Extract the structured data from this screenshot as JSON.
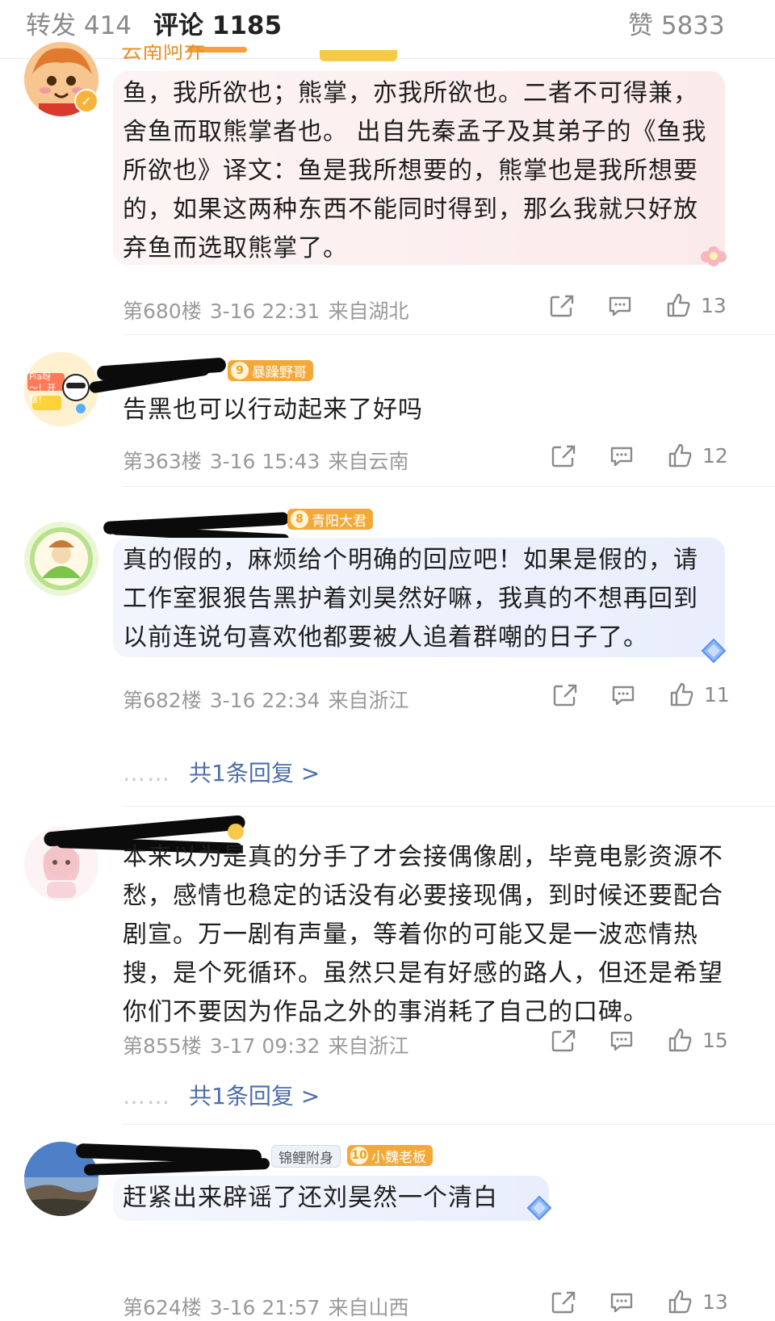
{
  "tabs": {
    "repost": "转发 414",
    "comments": "评论 1185",
    "likes": "赞 5833"
  },
  "comments": [
    {
      "text": "鱼，我所欲也；熊掌，亦我所欲也。二者不可得兼，舍鱼而取熊掌者也。 出自先秦孟子及其弟子的《鱼我所欲也》译文：鱼是我所想要的，熊掌也是我所想要的，如果这两种东西不能同时得到，那么我就只好放弃鱼而选取熊掌了。",
      "floor": "第680楼",
      "time": "3-16 22:31",
      "location": "来自湖北",
      "likes": "13",
      "name_visible": "云南阿乔"
    },
    {
      "text": "告黑也可以行动起来了好吗",
      "floor": "第363楼",
      "time": "3-16 15:43",
      "location": "来自云南",
      "likes": "12",
      "badge_level": "9",
      "badge_text": "暴躁野哥",
      "avatar_text": "Pia呀～！开摆！"
    },
    {
      "text": "真的假的，麻烦给个明确的回应吧！如果是假的，请工作室狠狠告黑护着刘昊然好嘛，我真的不想再回到以前连说句喜欢他都要被人追着群嘲的日子了。",
      "floor": "第682楼",
      "time": "3-16 22:34",
      "location": "来自浙江",
      "likes": "11",
      "badge_level": "8",
      "badge_text": "青阳大君",
      "reply_link": "共1条回复 >"
    },
    {
      "text": "本来以为是真的分手了才会接偶像剧，毕竟电影资源不愁，感情也稳定的话没有必要接现偶，到时候还要配合剧宣。万一剧有声量，等着你的可能又是一波恋情热搜，是个死循环。虽然只是有好感的路人，但还是希望你们不要因为作品之外的事消耗了自己的口碑。",
      "floor": "第855楼",
      "time": "3-17 09:32",
      "location": "来自浙江",
      "likes": "15",
      "reply_link": "共1条回复 >"
    },
    {
      "text": "赶紧出来辟谣了还刘昊然一个清白",
      "floor": "第624楼",
      "time": "3-16 21:57",
      "location": "来自山西",
      "likes": "13",
      "badge1_text": "锦鲤附身",
      "badge_level": "10",
      "badge_text": "小魏老板"
    }
  ],
  "reply_dots": "……",
  "colors": {
    "accent": "#f5a03c",
    "link": "#4b6ea8",
    "meta": "#9a9a9a"
  },
  "icons": [
    "share-icon",
    "comment-icon",
    "thumbs-up-icon",
    "verified-icon",
    "diamond-icon",
    "flower-icon"
  ]
}
